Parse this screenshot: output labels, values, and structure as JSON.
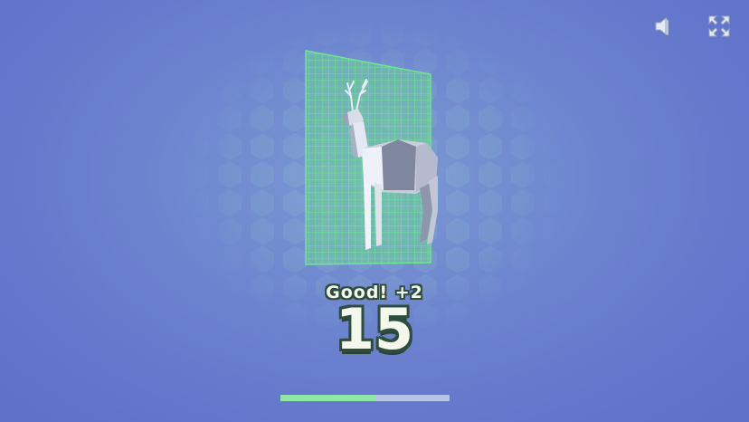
{
  "hud": {
    "sound_icon": "speaker-icon",
    "fullscreen_icon": "fullscreen-icon"
  },
  "stage": {
    "target": "deer",
    "grid_color": "#6de890",
    "hex_color": "#8fc4c8"
  },
  "result": {
    "feedback": "Good! +2",
    "score": "15"
  },
  "progress": {
    "value": 0.56,
    "fill_color": "#8fe6a6",
    "track_color": "#b8c3e6"
  },
  "colors": {
    "background": "#6478cc",
    "text_fill": "#f3f7ec",
    "text_outline": "#2f4d3f"
  }
}
